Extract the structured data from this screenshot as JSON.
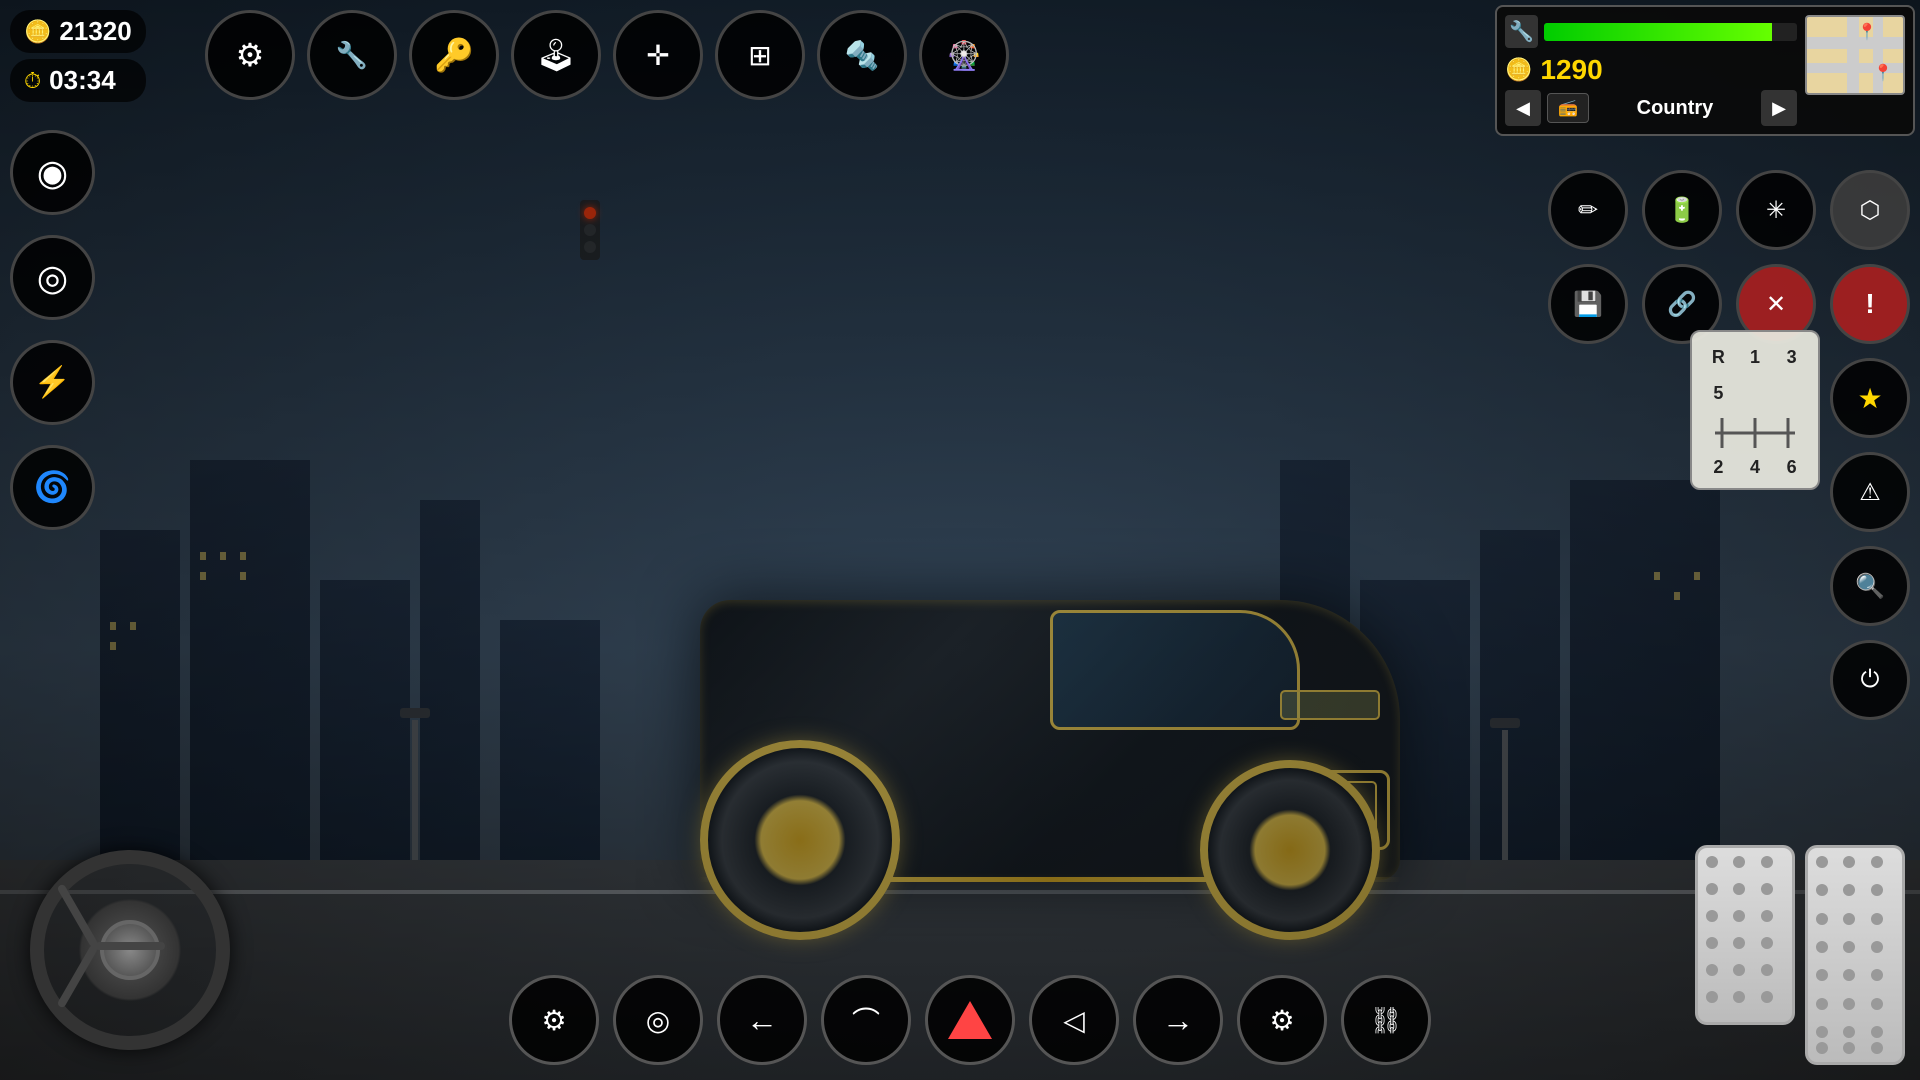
{
  "stats": {
    "coins": "21320",
    "coins_icon": "🪙",
    "time": "03:34",
    "time_icon": "⏱"
  },
  "top_toolbar": [
    {
      "name": "settings-btn",
      "icon": "⚙",
      "label": "Settings"
    },
    {
      "name": "tuning-btn",
      "icon": "🔧",
      "label": "Tuning"
    },
    {
      "name": "keys-btn",
      "icon": "🔑",
      "label": "Keys"
    },
    {
      "name": "gearbox-btn",
      "icon": "🕹",
      "label": "Gearbox"
    },
    {
      "name": "wrench-cross-btn",
      "icon": "✛",
      "label": "Repair"
    },
    {
      "name": "transmission-btn",
      "icon": "⊞",
      "label": "Transmission"
    },
    {
      "name": "bolt-btn",
      "icon": "🔩",
      "label": "Bolt"
    },
    {
      "name": "wheel-btn",
      "icon": "🎡",
      "label": "Wheel"
    }
  ],
  "left_panel": [
    {
      "name": "speedometer-btn",
      "icon": "◉",
      "label": "Speedometer"
    },
    {
      "name": "rim-btn",
      "icon": "◎",
      "label": "Rim"
    },
    {
      "name": "connector-btn",
      "icon": "⚡",
      "label": "Connector"
    },
    {
      "name": "turbine-btn",
      "icon": "🌀",
      "label": "Turbine"
    }
  ],
  "right_panel": {
    "row1": [
      {
        "name": "spark-btn",
        "icon": "✏",
        "label": "Spark"
      },
      {
        "name": "battery-btn",
        "icon": "▬",
        "label": "Battery"
      },
      {
        "name": "fan-btn",
        "icon": "✳",
        "label": "Fan"
      },
      {
        "name": "halfcut-btn",
        "icon": "⬡",
        "label": "Half Cut"
      }
    ],
    "row2": [
      {
        "name": "save-btn",
        "icon": "💾",
        "label": "Save"
      },
      {
        "name": "share-btn",
        "icon": "🔗",
        "label": "Share"
      },
      {
        "name": "close-btn",
        "icon": "✕",
        "label": "Close"
      },
      {
        "name": "alert-btn",
        "icon": "!",
        "label": "Alert"
      }
    ],
    "row3": [
      {
        "name": "favorite-btn",
        "icon": "★",
        "label": "Favorite"
      }
    ],
    "row4": [
      {
        "name": "warning-btn",
        "icon": "⚠",
        "label": "Warning"
      }
    ],
    "row5": [
      {
        "name": "search-btn",
        "icon": "🔍",
        "label": "Search"
      }
    ],
    "row6": [
      {
        "name": "power-btn",
        "icon": "⏻",
        "label": "Power"
      }
    ]
  },
  "info_panel": {
    "fuel_label": "Fuel",
    "coin_value": "1290",
    "coin_icon": "🪙",
    "nav_left": "◀",
    "nav_right": "▶",
    "radio_icon": "📻",
    "location": "Country",
    "map_alt": "Mini Map"
  },
  "gear_display": {
    "gears": [
      "R",
      "1",
      "3",
      "5",
      "",
      "",
      "2",
      "4",
      "6"
    ]
  },
  "bottom_toolbar": [
    {
      "name": "turbo-btn",
      "icon": "⚙",
      "label": "Turbo"
    },
    {
      "name": "brake-disc-btn",
      "icon": "◎",
      "label": "Brake Disc"
    },
    {
      "name": "left-arrow-btn",
      "icon": "←",
      "label": "Turn Left"
    },
    {
      "name": "wiper-btn",
      "icon": "⌒",
      "label": "Wiper"
    },
    {
      "name": "hazard-btn",
      "icon": "▲",
      "label": "Hazard"
    },
    {
      "name": "headlight-btn",
      "icon": "◁",
      "label": "Headlight"
    },
    {
      "name": "right-arrow-btn",
      "icon": "→",
      "label": "Turn Right"
    },
    {
      "name": "engine-btn",
      "icon": "⚙",
      "label": "Engine"
    },
    {
      "name": "chain-btn",
      "icon": "⛓",
      "label": "Chain"
    }
  ],
  "pedals": {
    "brake_label": "Brake",
    "gas_label": "Gas"
  }
}
